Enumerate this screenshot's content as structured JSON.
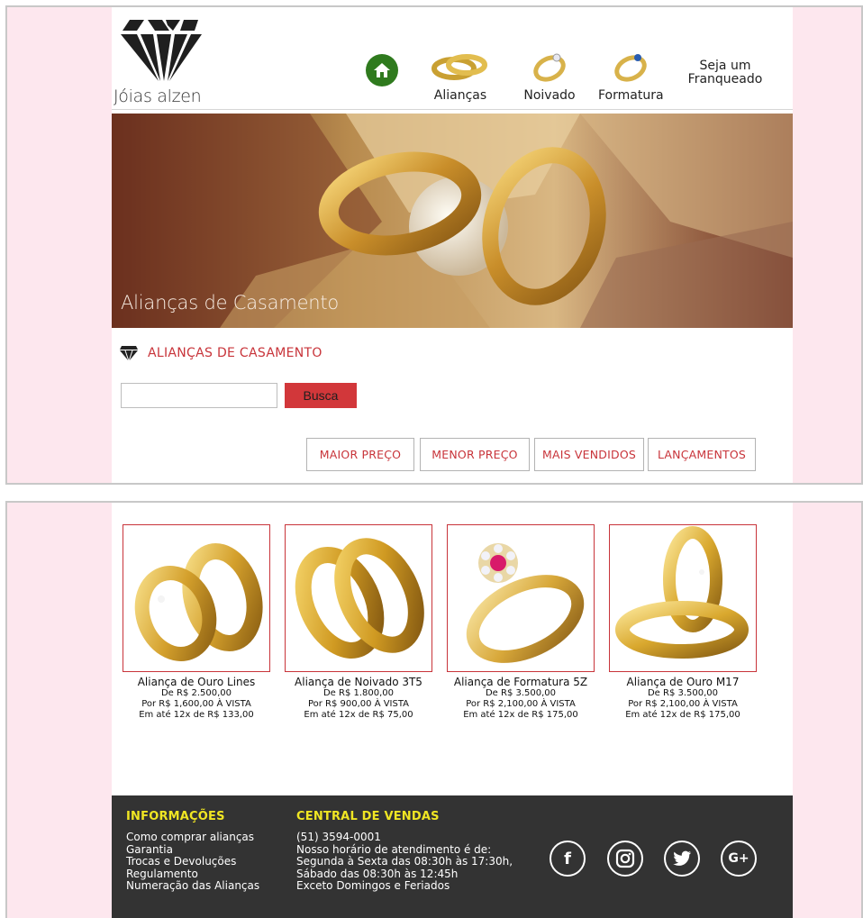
{
  "brand": {
    "name": "Jóias alzen"
  },
  "nav": {
    "items": [
      {
        "label": "Alianças",
        "icon": "wedding-rings-icon"
      },
      {
        "label": "Noivado",
        "icon": "engagement-ring-icon"
      },
      {
        "label": "Formatura",
        "icon": "graduation-ring-icon"
      }
    ],
    "franchise_line1": "Seja um",
    "franchise_line2": "Franqueado",
    "home_icon": "home-icon"
  },
  "hero": {
    "caption": "Alianças de Casamento"
  },
  "section": {
    "title": "ALIANÇAS DE CASAMENTO"
  },
  "search": {
    "value": "",
    "placeholder": "",
    "button_label": "Busca"
  },
  "sort": {
    "options": [
      "MAIOR PREÇO",
      "MENOR PREÇO",
      "MAIS VENDIDOS",
      "LANÇAMENTOS"
    ]
  },
  "products": [
    {
      "name": "Aliança de Ouro Lines",
      "price_from": "De R$ 2.500,00",
      "price_cash": "Por R$ 1,600,00 À VISTA",
      "installments": "Em até 12x de R$ 133,00"
    },
    {
      "name": "Aliança de Noivado 3T5",
      "price_from": "De R$ 1.800,00",
      "price_cash": "Por R$ 900,00 À VISTA",
      "installments": "Em até 12x de R$ 75,00"
    },
    {
      "name": "Aliança de Formatura 5Z",
      "price_from": "De R$ 3.500,00",
      "price_cash": "Por R$ 2,100,00 À VISTA",
      "installments": "Em até 12x de R$ 175,00"
    },
    {
      "name": "Aliança de Ouro M17",
      "price_from": "De R$ 3.500,00",
      "price_cash": "Por R$ 2,100,00 À VISTA",
      "installments": "Em até 12x de R$ 175,00"
    }
  ],
  "footer": {
    "info_heading": "INFORMAÇÕES",
    "info_links": [
      "Como comprar alianças",
      "Garantia",
      "Trocas e Devoluções",
      "Regulamento",
      "Numeração das Alianças"
    ],
    "sales_heading": "CENTRAL DE VENDAS",
    "sales_lines": [
      "(51) 3594-0001",
      "Nosso horário de atendimento é de:",
      "Segunda à Sexta das 08:30h às 17:30h,",
      "Sábado das 08:30h às 12:45h",
      "Exceto Domingos e Feriados"
    ],
    "social": [
      {
        "icon": "facebook-icon",
        "glyph": "f"
      },
      {
        "icon": "instagram-icon",
        "glyph": ""
      },
      {
        "icon": "twitter-icon",
        "glyph": ""
      },
      {
        "icon": "google-plus-icon",
        "glyph": "G+"
      }
    ]
  },
  "colors": {
    "accent": "#c8343a",
    "footer_bg": "#333333",
    "footer_heading": "#f0e623",
    "page_bg": "#fde7ee",
    "home_green": "#2f7a1e"
  }
}
